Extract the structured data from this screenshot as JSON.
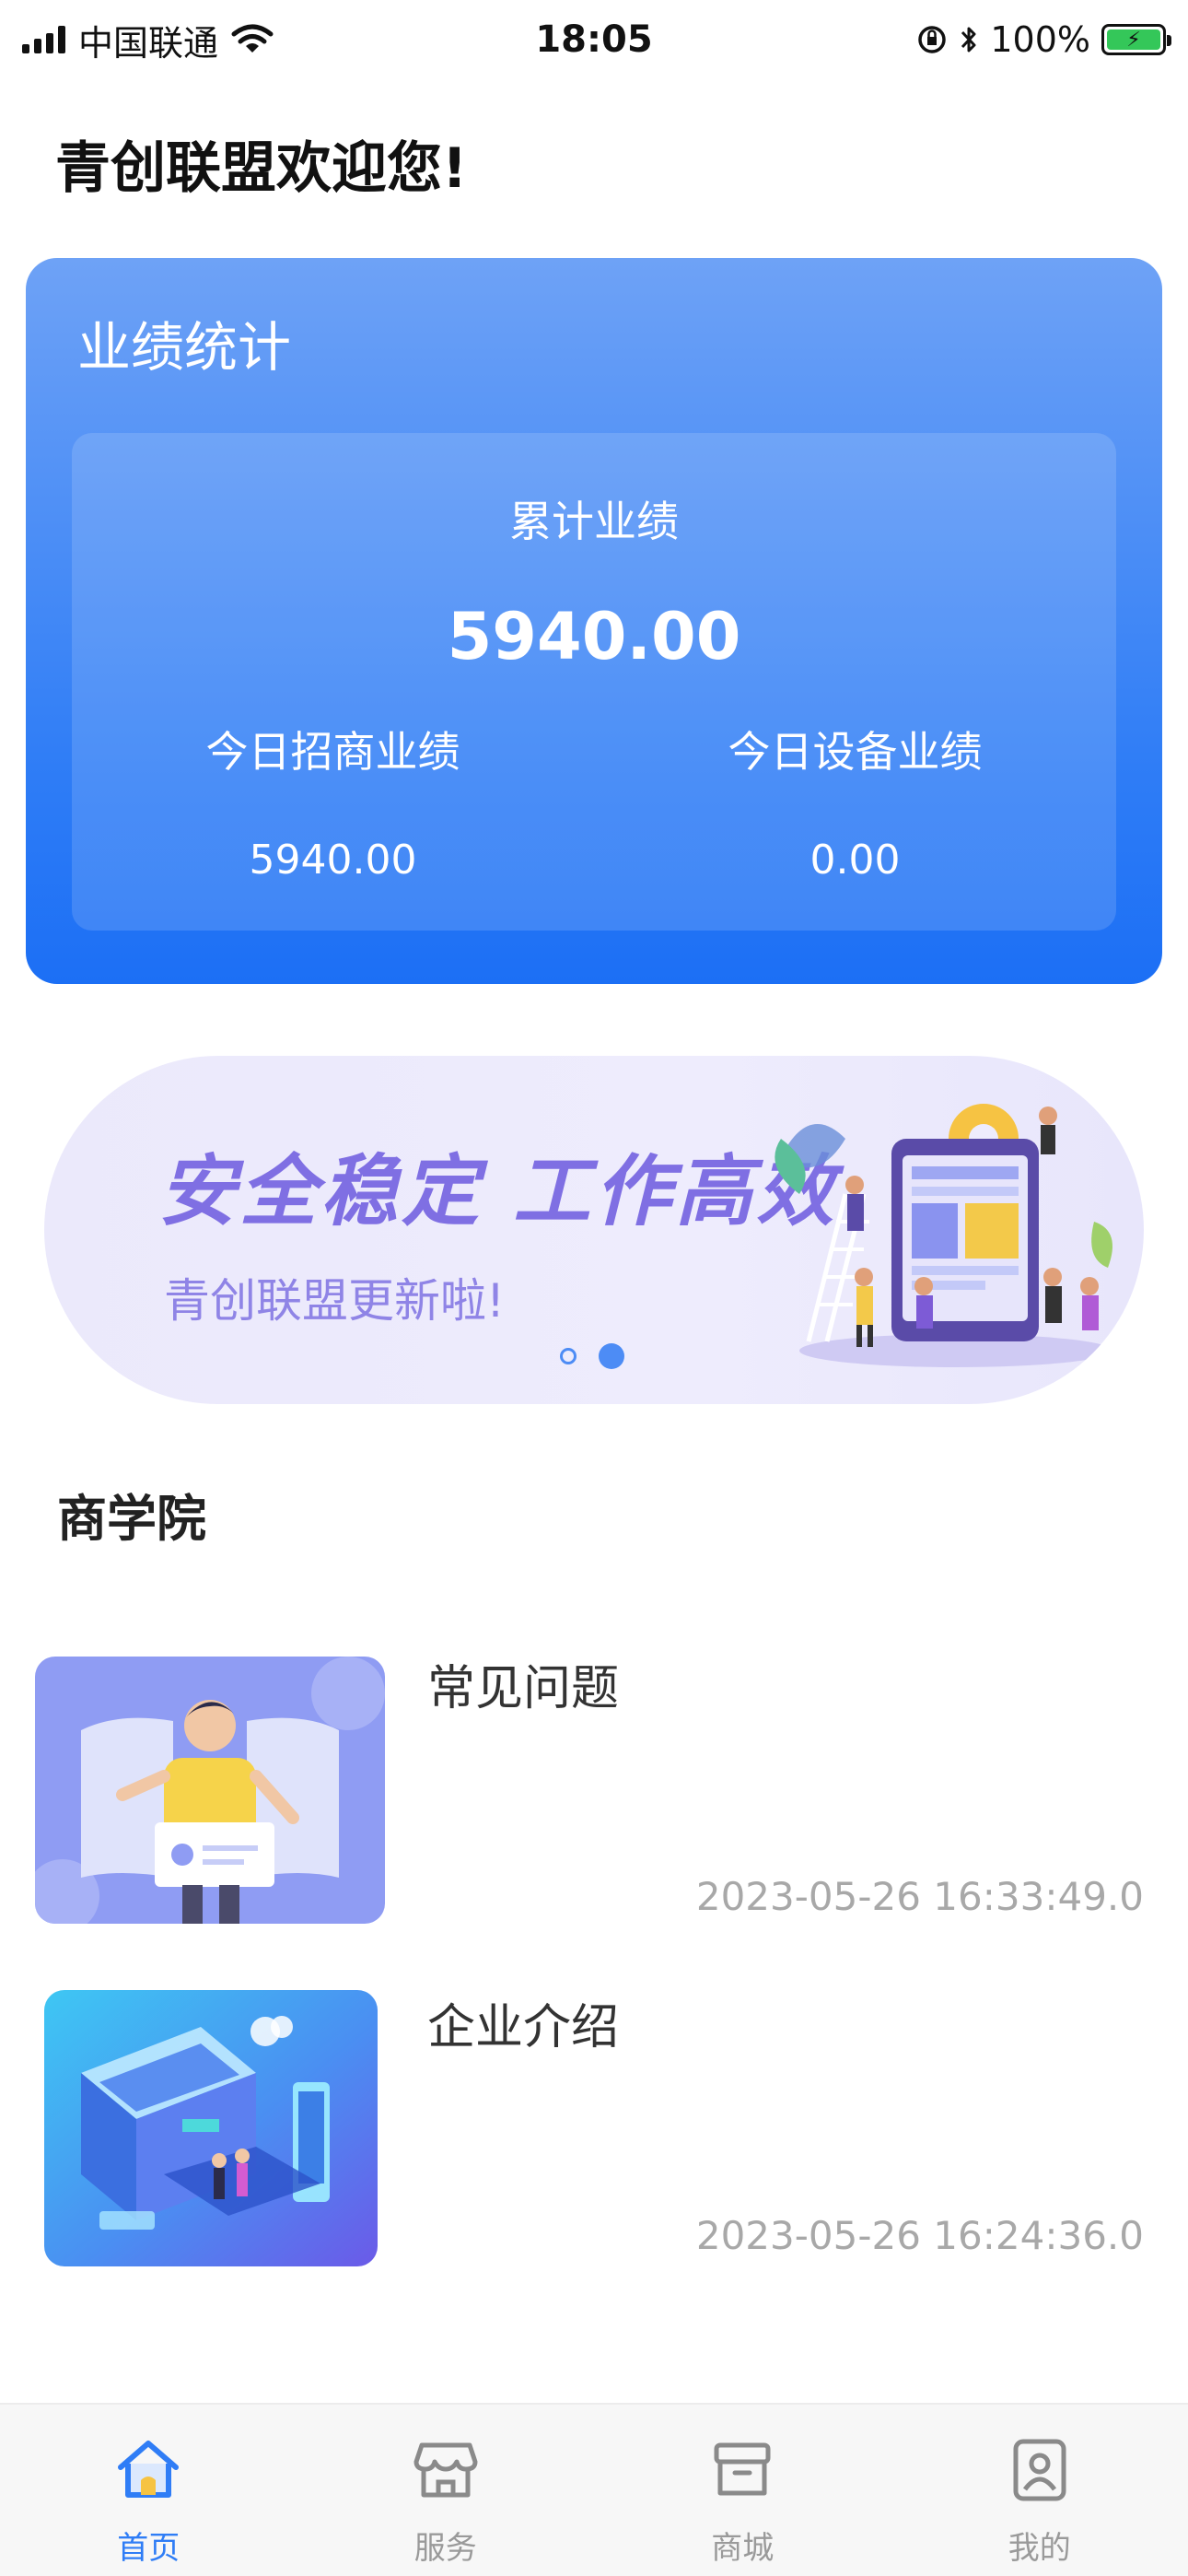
{
  "status_bar": {
    "carrier": "中国联通",
    "time": "18:05",
    "battery": "100%"
  },
  "greeting": "青创联盟欢迎您!",
  "stats": {
    "title": "业绩统计",
    "total_label": "累计业绩",
    "total_value": "5940.00",
    "today_merchant_label": "今日招商业绩",
    "today_merchant_value": "5940.00",
    "today_device_label": "今日设备业绩",
    "today_device_value": "0.00"
  },
  "banner": {
    "title": "安全稳定 工作高效",
    "subtitle": "青创联盟更新啦!",
    "slide_count": 2,
    "active_slide": 2
  },
  "section": {
    "title": "商学院"
  },
  "articles": [
    {
      "title": "常见问题",
      "date": "2023-05-26 16:33:49.0"
    },
    {
      "title": "企业介绍",
      "date": "2023-05-26 16:24:36.0"
    }
  ],
  "tabs": [
    {
      "label": "首页",
      "icon": "home-icon",
      "active": true
    },
    {
      "label": "服务",
      "icon": "store-icon",
      "active": false
    },
    {
      "label": "商城",
      "icon": "box-icon",
      "active": false
    },
    {
      "label": "我的",
      "icon": "profile-icon",
      "active": false
    }
  ],
  "colors": {
    "accent": "#2f7df6",
    "banner_text": "#7f6fe3",
    "date_text": "#a8a8a8"
  }
}
